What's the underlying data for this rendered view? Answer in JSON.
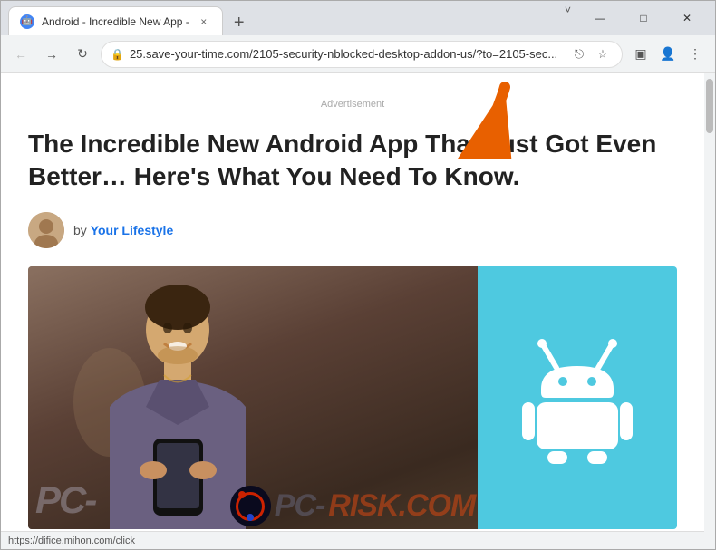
{
  "browser": {
    "tab": {
      "favicon": "🤖",
      "title": "Android - Incredible New App -",
      "close_label": "×"
    },
    "new_tab_label": "+",
    "window_controls": {
      "minimize": "—",
      "maximize": "□",
      "close": "✕"
    },
    "chevron": "˅"
  },
  "toolbar": {
    "back_label": "←",
    "forward_label": "→",
    "reload_label": "↻",
    "url": "25.save-your-time.com/2105-security-nblocked-desktop-addon-us/?to=2105-sec...",
    "share_icon": "⎋",
    "star_icon": "☆",
    "extensions_icon": "▣",
    "profile_icon": "👤",
    "menu_icon": "⋮"
  },
  "page": {
    "advertisement_label": "Advertisement",
    "article": {
      "title": "The Incredible New Android App That Just Got Even Better… Here's What You Need To Know.",
      "author_prefix": "by",
      "author_name": "Your Lifestyle"
    }
  },
  "status_bar": {
    "url": "https://difice.mihon.com/click"
  },
  "watermark": {
    "prefix": "PC-",
    "suffix": "RISK.COM"
  }
}
